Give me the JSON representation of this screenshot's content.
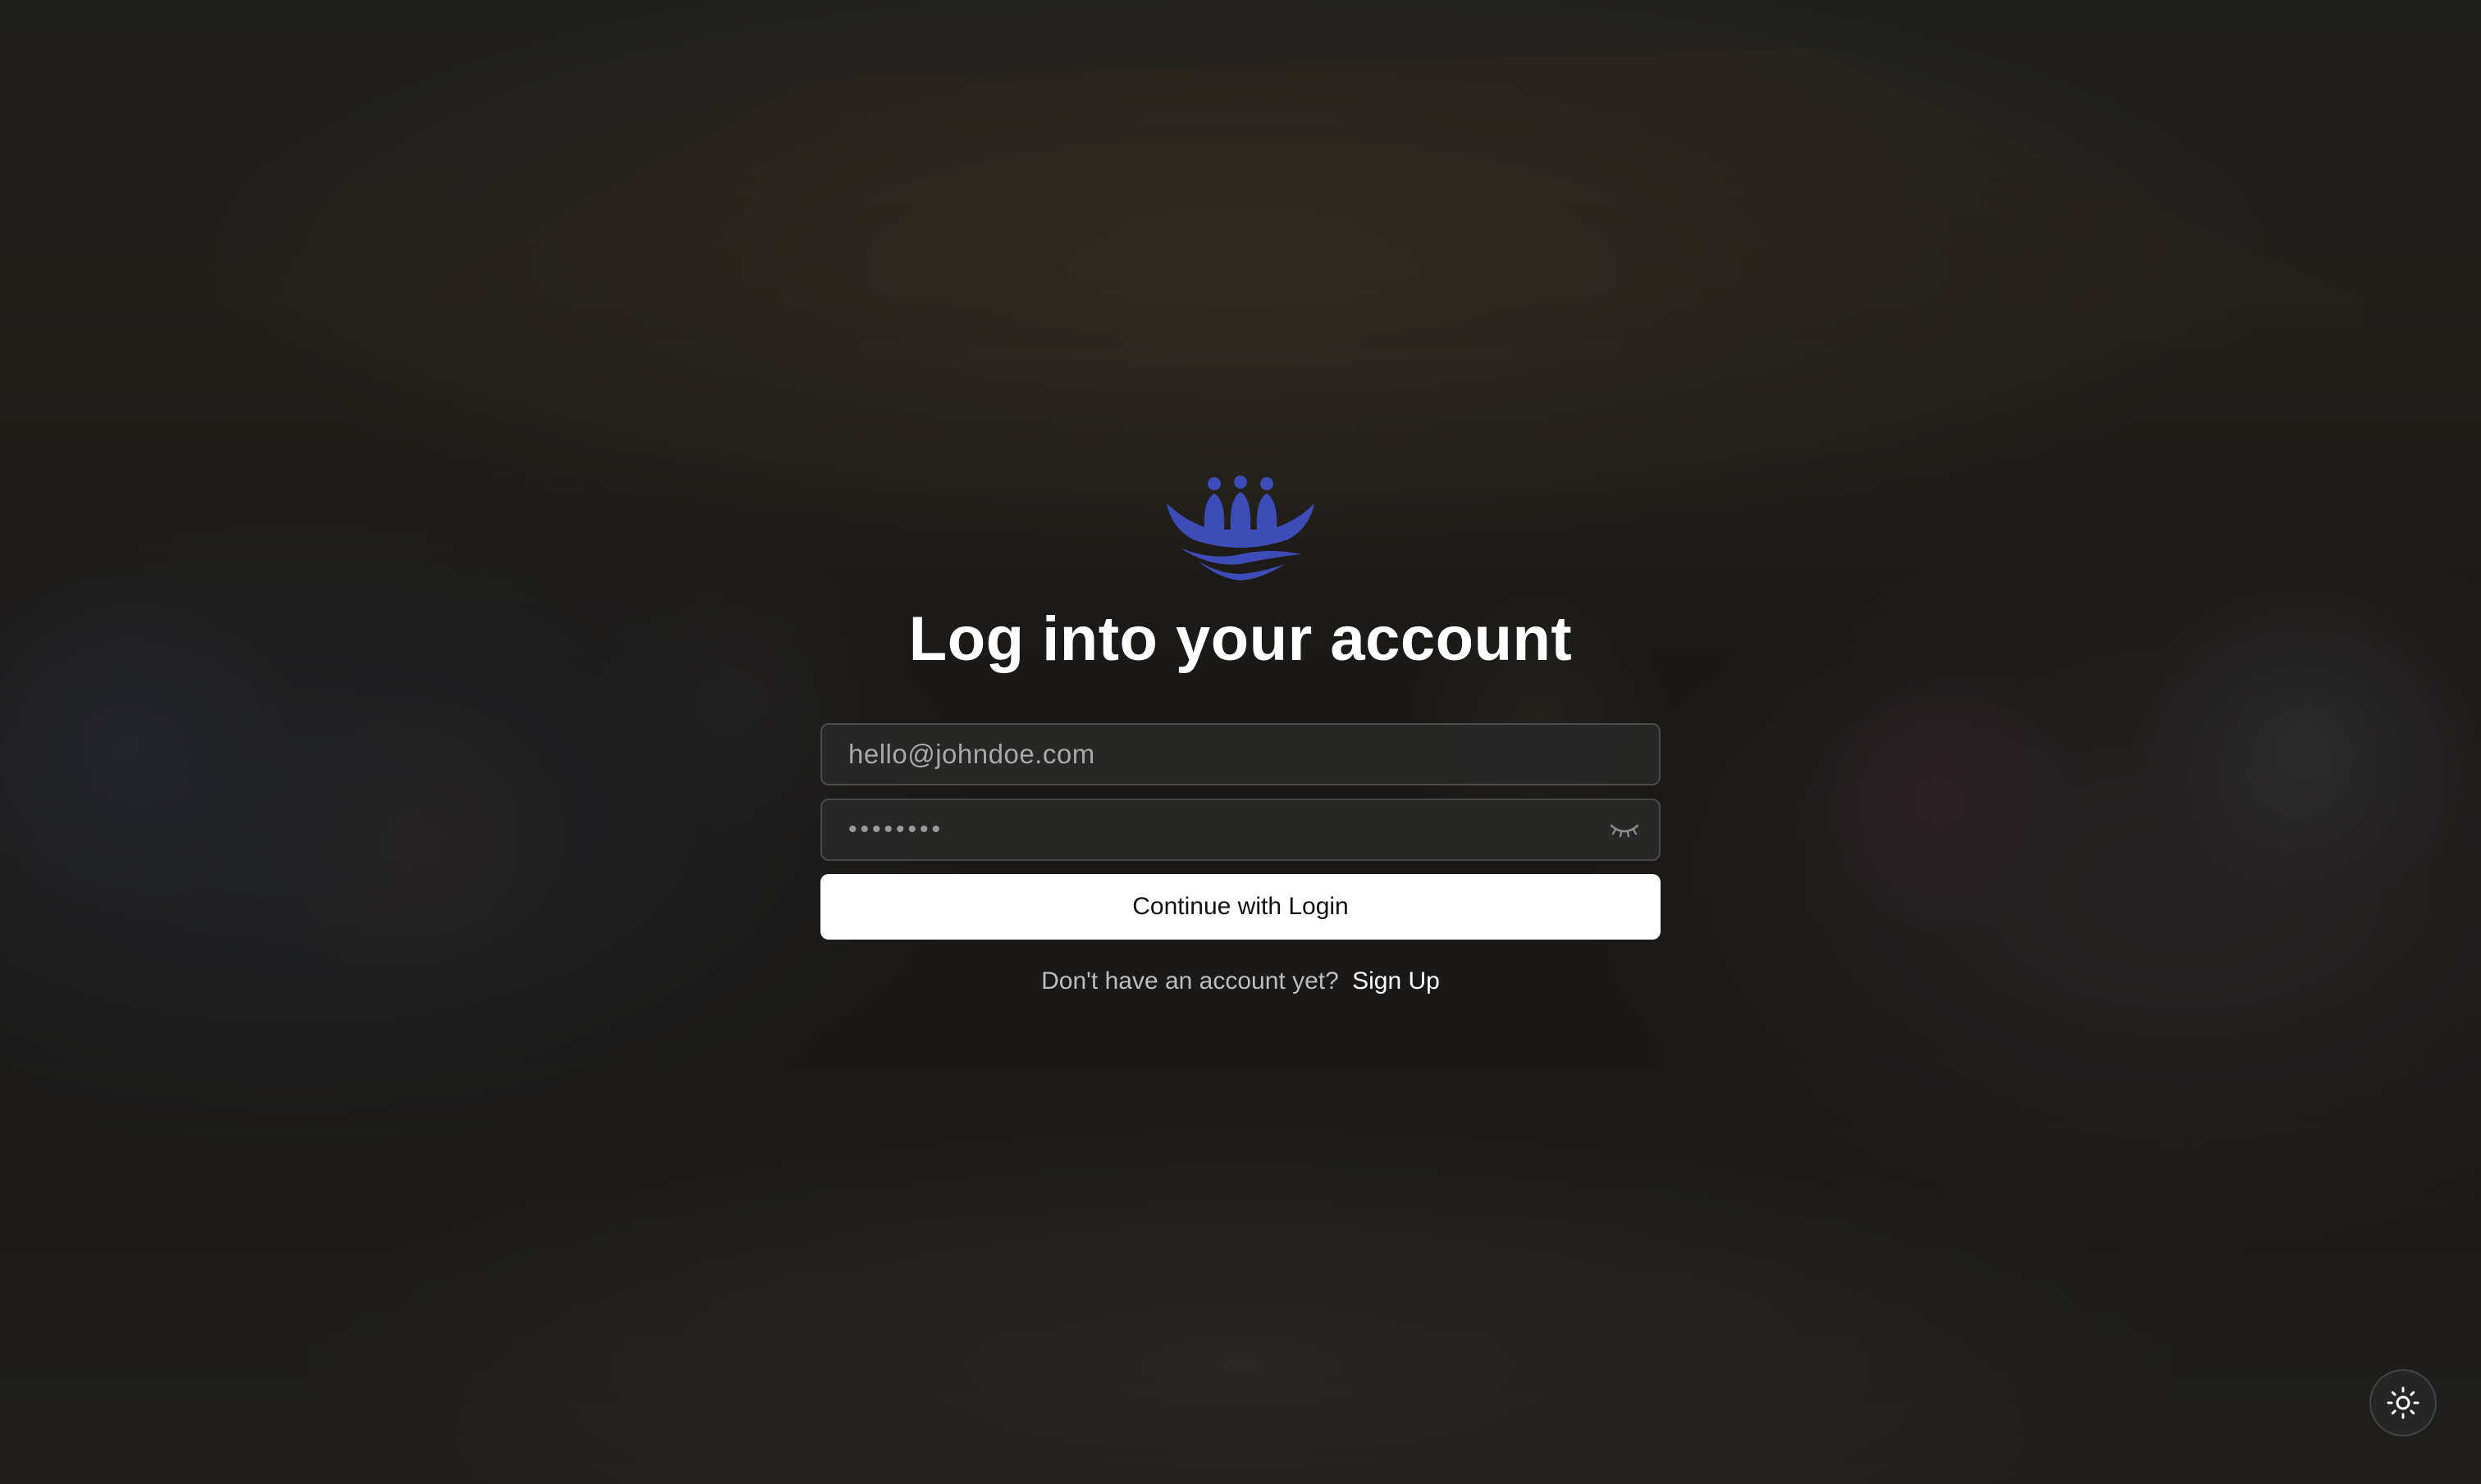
{
  "page": {
    "title": "Log into your account"
  },
  "form": {
    "email_placeholder": "hello@johndoe.com",
    "email_value": "",
    "password_masked": "••••••••",
    "submit_label": "Continue with Login"
  },
  "signup": {
    "prompt": "Don't have an account yet?",
    "link_label": "Sign Up"
  },
  "icons": {
    "logo": "boat-people-logo",
    "password_toggle": "eye-closed-icon",
    "theme_toggle": "sun-icon"
  },
  "colors": {
    "brand": "#3d4cb8",
    "button_bg": "#ffffff",
    "field_bg": "#282828"
  }
}
